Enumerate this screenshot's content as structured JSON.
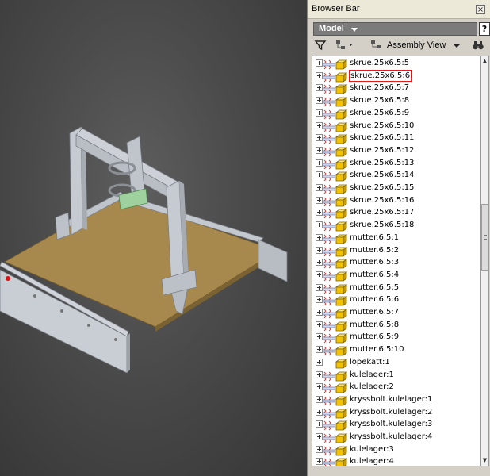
{
  "panel": {
    "title": "Browser Bar",
    "close_label": "×",
    "model_label": "Model",
    "help_label": "?",
    "view_label": "Assembly View"
  },
  "tree_items": [
    {
      "label": "skrue.25x6.5:5",
      "selected": false,
      "constraint": true
    },
    {
      "label": "skrue.25x6.5:6",
      "selected": true,
      "constraint": true
    },
    {
      "label": "skrue.25x6.5:7",
      "selected": false,
      "constraint": true
    },
    {
      "label": "skrue.25x6.5:8",
      "selected": false,
      "constraint": true
    },
    {
      "label": "skrue.25x6.5:9",
      "selected": false,
      "constraint": true
    },
    {
      "label": "skrue.25x6.5:10",
      "selected": false,
      "constraint": true
    },
    {
      "label": "skrue.25x6.5:11",
      "selected": false,
      "constraint": true
    },
    {
      "label": "skrue.25x6.5:12",
      "selected": false,
      "constraint": true
    },
    {
      "label": "skrue.25x6.5:13",
      "selected": false,
      "constraint": true
    },
    {
      "label": "skrue.25x6.5:14",
      "selected": false,
      "constraint": true
    },
    {
      "label": "skrue.25x6.5:15",
      "selected": false,
      "constraint": true
    },
    {
      "label": "skrue.25x6.5:16",
      "selected": false,
      "constraint": true
    },
    {
      "label": "skrue.25x6.5:17",
      "selected": false,
      "constraint": true
    },
    {
      "label": "skrue.25x6.5:18",
      "selected": false,
      "constraint": true
    },
    {
      "label": "mutter.6.5:1",
      "selected": false,
      "constraint": true
    },
    {
      "label": "mutter.6.5:2",
      "selected": false,
      "constraint": true
    },
    {
      "label": "mutter.6.5:3",
      "selected": false,
      "constraint": true
    },
    {
      "label": "mutter.6.5:4",
      "selected": false,
      "constraint": true
    },
    {
      "label": "mutter.6.5:5",
      "selected": false,
      "constraint": true
    },
    {
      "label": "mutter.6.5:6",
      "selected": false,
      "constraint": true
    },
    {
      "label": "mutter.6.5:7",
      "selected": false,
      "constraint": true
    },
    {
      "label": "mutter.6.5:8",
      "selected": false,
      "constraint": true
    },
    {
      "label": "mutter.6.5:9",
      "selected": false,
      "constraint": true
    },
    {
      "label": "mutter.6.5:10",
      "selected": false,
      "constraint": true
    },
    {
      "label": "lopekatt:1",
      "selected": false,
      "constraint": false
    },
    {
      "label": "kulelager:1",
      "selected": false,
      "constraint": true
    },
    {
      "label": "kulelager:2",
      "selected": false,
      "constraint": true
    },
    {
      "label": "kryssbolt.kulelager:1",
      "selected": false,
      "constraint": true
    },
    {
      "label": "kryssbolt.kulelager:2",
      "selected": false,
      "constraint": true
    },
    {
      "label": "kryssbolt.kulelager:3",
      "selected": false,
      "constraint": true
    },
    {
      "label": "kryssbolt.kulelager:4",
      "selected": false,
      "constraint": true
    },
    {
      "label": "kulelager:3",
      "selected": false,
      "constraint": true
    },
    {
      "label": "kulelager:4",
      "selected": false,
      "constraint": true
    }
  ],
  "icons": {
    "filter": "filter-icon",
    "hierarchy": "hierarchy-icon",
    "assembly_view": "assembly-view-icon",
    "find": "binoculars-icon",
    "part": "part-cube-icon",
    "constraint": "constraint-spring-icon"
  },
  "colors": {
    "cube": "#f2c200",
    "selection": "#e21a1a",
    "spring": "#d23a3a",
    "board": "#a88a4e"
  }
}
